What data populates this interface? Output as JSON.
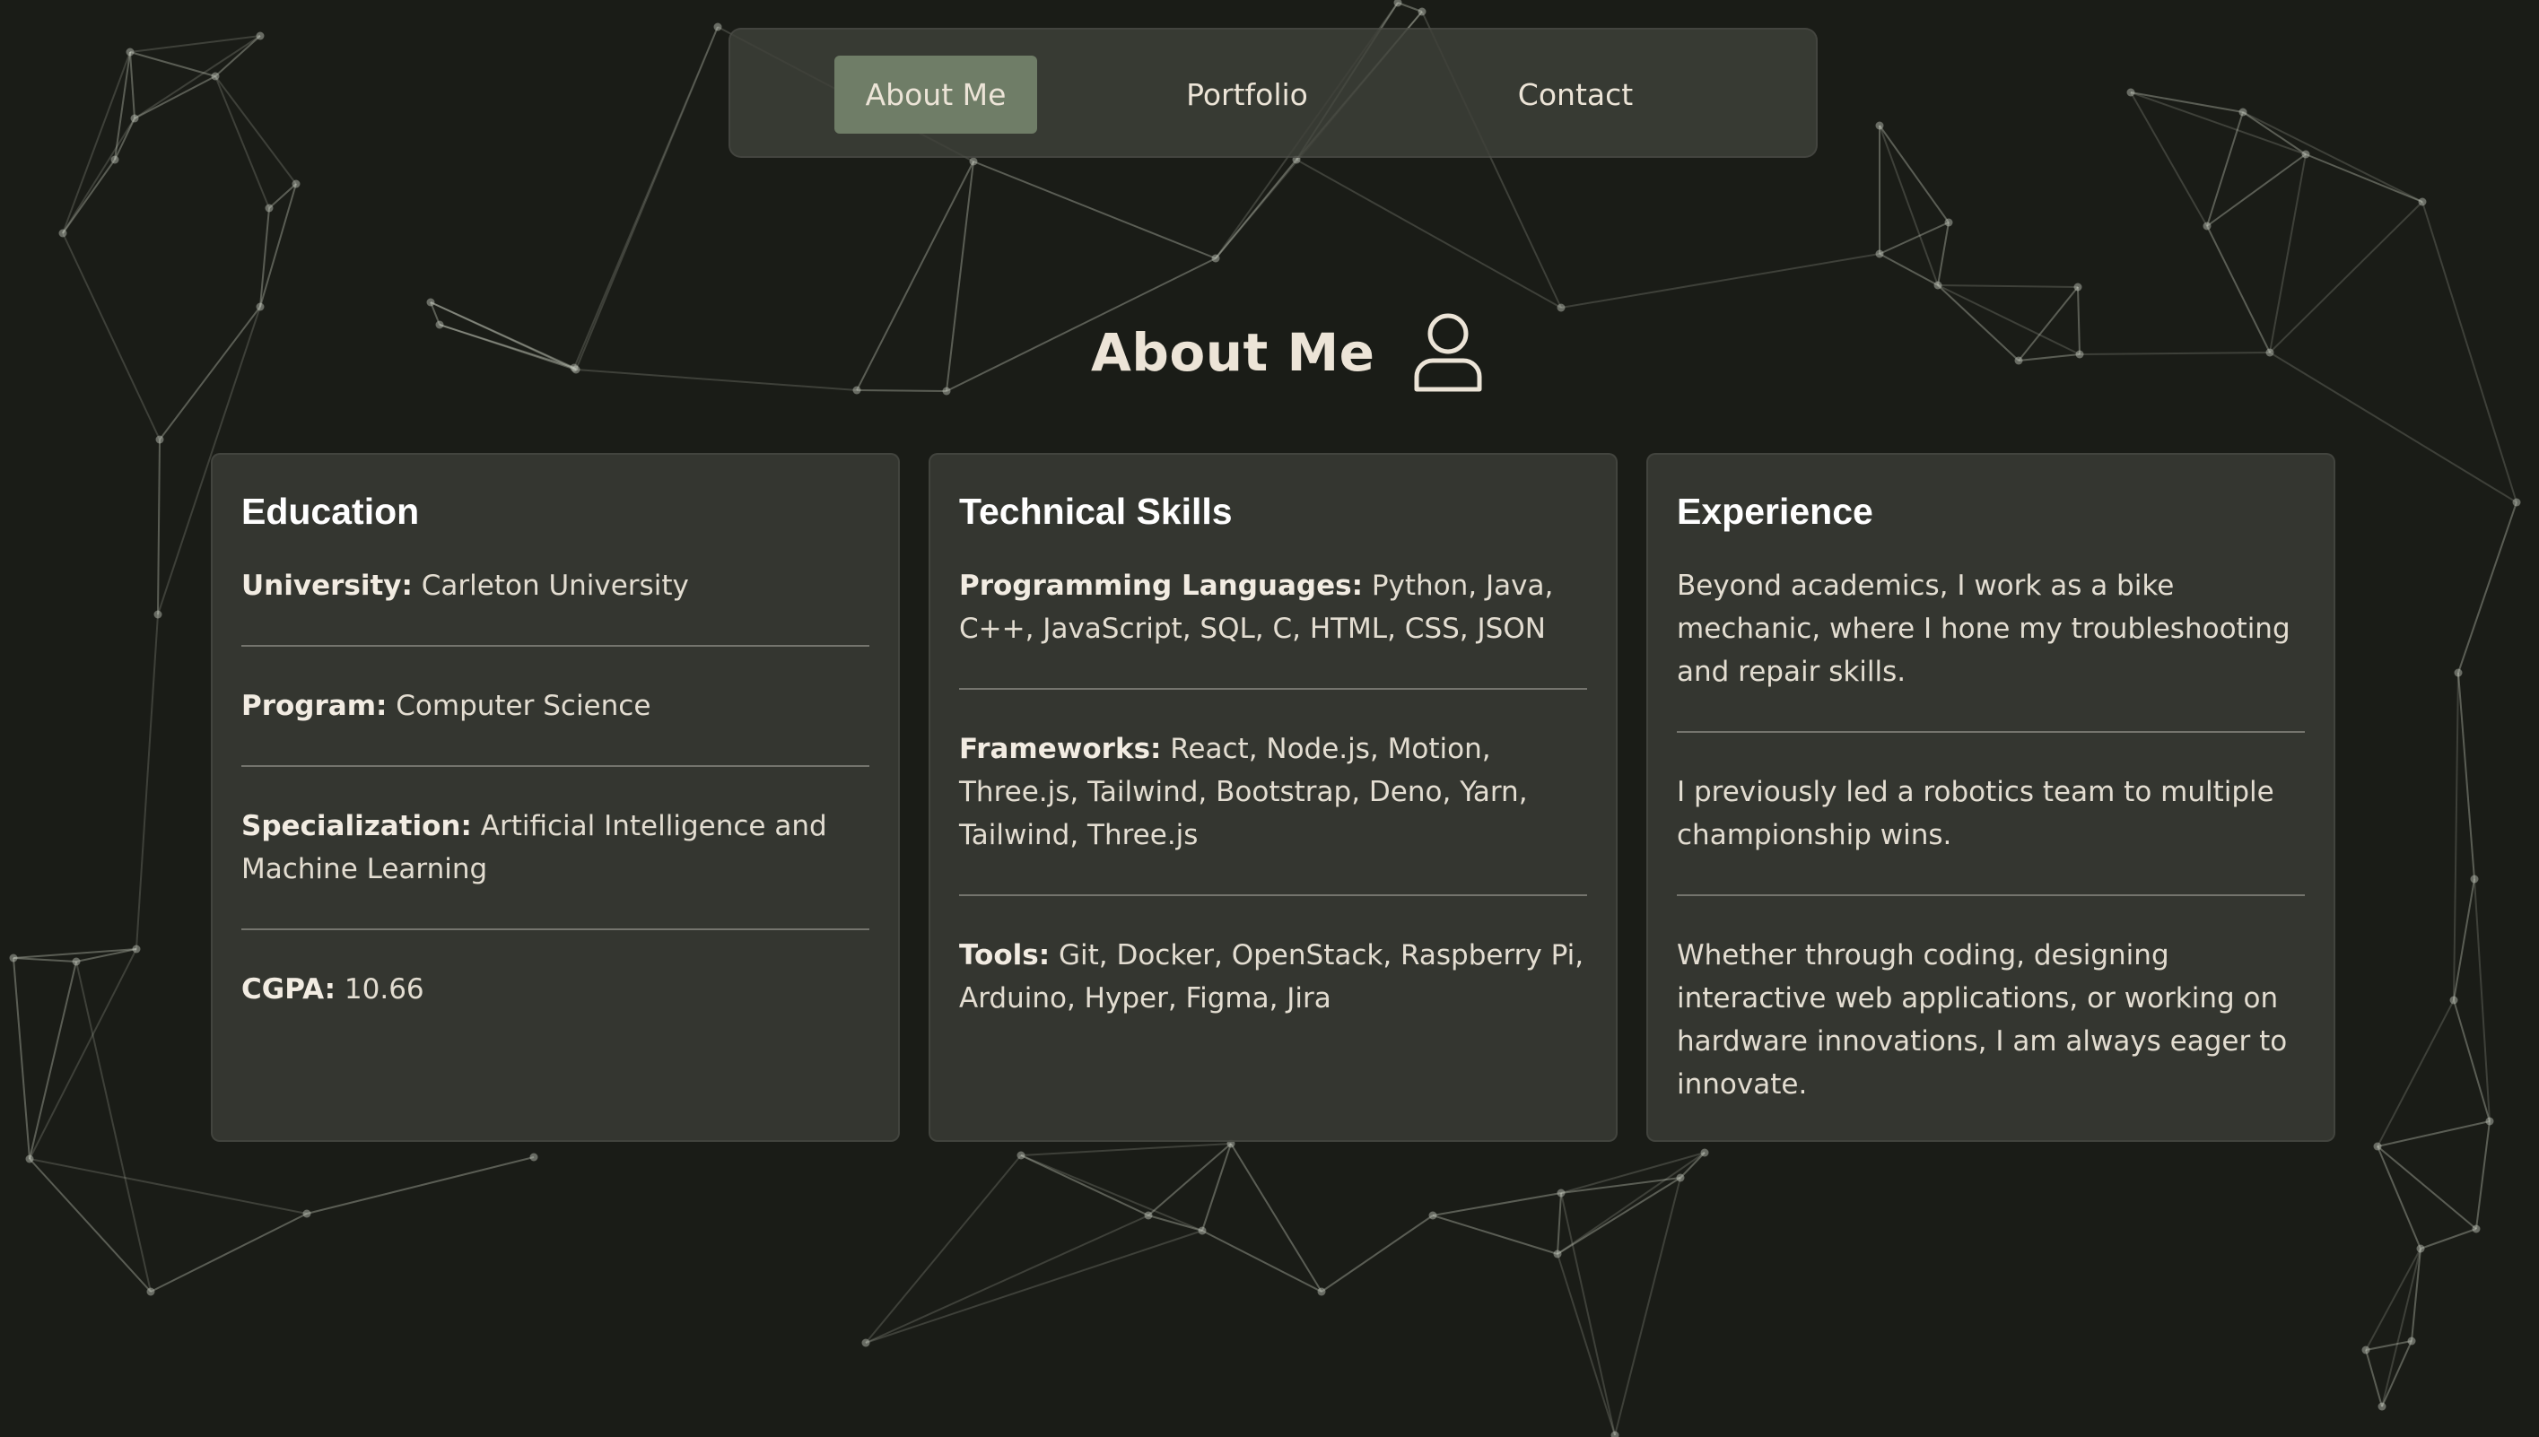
{
  "nav": {
    "items": [
      {
        "label": "About Me",
        "active": true
      },
      {
        "label": "Portfolio",
        "active": false
      },
      {
        "label": "Contact",
        "active": false
      }
    ]
  },
  "section": {
    "title": "About Me",
    "icon": "user-icon"
  },
  "cards": {
    "education": {
      "heading": "Education",
      "entries": [
        {
          "label": "University:",
          "value": " Carleton University"
        },
        {
          "label": "Program:",
          "value": " Computer Science"
        },
        {
          "label": "Specialization:",
          "value": " Artificial Intelligence and Machine Learning"
        },
        {
          "label": "CGPA:",
          "value": " 10.66"
        }
      ]
    },
    "skills": {
      "heading": "Technical Skills",
      "entries": [
        {
          "label": "Programming Languages:",
          "value": " Python, Java, C++, JavaScript, SQL, C, HTML, CSS, JSON"
        },
        {
          "label": "Frameworks:",
          "value": " React, Node.js, Motion, Three.js, Tailwind, Bootstrap, Deno, Yarn, Tailwind, Three.js"
        },
        {
          "label": "Tools:",
          "value": " Git, Docker, OpenStack, Raspberry Pi, Arduino, Hyper, Figma, Jira"
        }
      ]
    },
    "experience": {
      "heading": "Experience",
      "entries": [
        {
          "text": "Beyond academics, I work as a bike mechanic, where I hone my troubleshooting and repair skills."
        },
        {
          "text": "I previously led a robotics team to multiple championship wins."
        },
        {
          "text": "Whether through coding, designing interactive web applications, or working on hardware innovations, I am always eager to innovate."
        }
      ]
    }
  },
  "colors": {
    "background": "#1a1c17",
    "card": "#363832",
    "nav_active": "#6f7d67",
    "text": "#ece4d7"
  }
}
